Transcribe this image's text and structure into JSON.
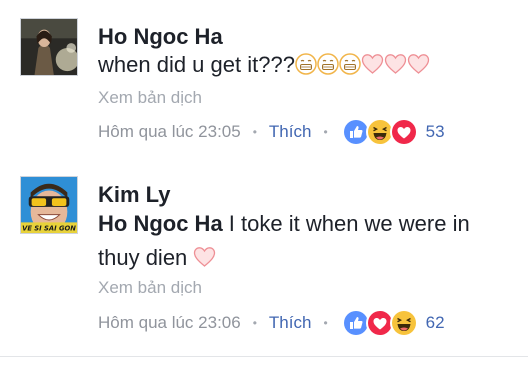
{
  "comments": [
    {
      "author": "Ho Ngoc Ha",
      "text": "when did u get it???",
      "emojis": [
        "grimacing-face",
        "grimacing-face",
        "grimacing-face",
        "heart",
        "heart",
        "heart"
      ],
      "translate_label": "Xem bản dịch",
      "timestamp": "Hôm qua lúc 23:05",
      "like_label": "Thích",
      "reactions": [
        "like",
        "haha",
        "love"
      ],
      "reaction_count": "53"
    },
    {
      "author": "Kim Ly",
      "mention": "Ho Ngoc Ha",
      "text": " I toke it when we were in thuy dien",
      "emojis": [
        "heart"
      ],
      "avatar_caption": "VE SI SAI GON",
      "translate_label": "Xem bản dịch",
      "timestamp": "Hôm qua lúc 23:06",
      "like_label": "Thích",
      "reactions": [
        "like",
        "love",
        "haha"
      ],
      "reaction_count": "62"
    }
  ],
  "colors": {
    "link_blue": "#4267b2",
    "text": "#1d2129",
    "muted": "#90949c",
    "love_red": "#f0284a",
    "haha_yellow": "#f7c33c",
    "heart_pink": "#f7b5b8"
  }
}
